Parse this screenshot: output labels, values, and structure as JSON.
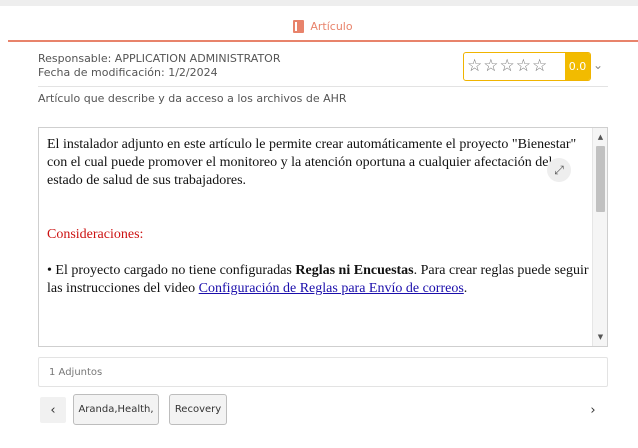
{
  "header": {
    "icon": "book-icon",
    "title": "Artículo"
  },
  "meta": {
    "responsible": "Responsable: APPLICATION ADMINISTRATOR",
    "modified": "Fecha de modificación: 1/2/2024"
  },
  "rating": {
    "stars_total": 5,
    "stars_filled": 0,
    "score": "0.0",
    "accent_color": "#f2bb00"
  },
  "description": "Artículo que describe y da acceso a los archivos de AHR",
  "content": {
    "paragraph1": "El instalador adjunto en este artículo le permite crear automáticamente el proyecto \"Bienestar\" con el cual puede promover el monitoreo y la atención oportuna a cualquier afectación del estado de salud de sus trabajadores.",
    "heading": "Consideraciones:",
    "bullet_prefix": "• El proyecto cargado no tiene configuradas ",
    "bullet_bold": "Reglas ni Encuestas",
    "bullet_mid": ". Para crear reglas puede seguir las instrucciones del  video ",
    "bullet_link": "Configuración de Reglas para Envío de correos",
    "bullet_suffix": "."
  },
  "attachments": {
    "label": "1 Adjuntos"
  },
  "tags": [
    "Aranda,Health,",
    "Recovery"
  ],
  "colors": {
    "accent": "#e8836b",
    "link": "#1a0dab",
    "heading_red": "#cc1111"
  }
}
